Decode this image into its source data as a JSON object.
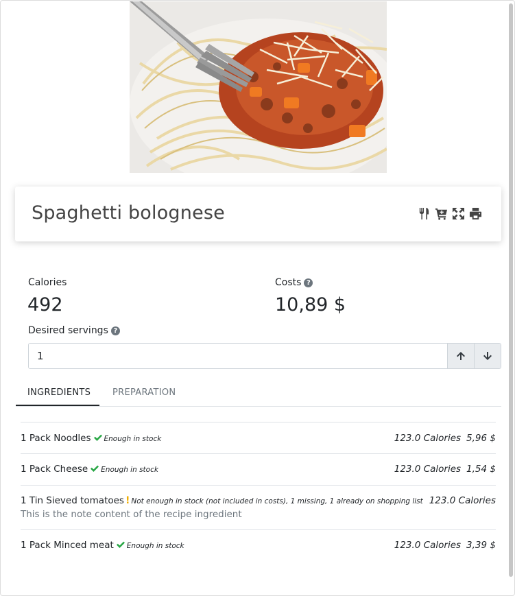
{
  "recipe": {
    "title": "Spaghetti bolognese",
    "hero_image": "spaghetti-bolognese-photo"
  },
  "actions": [
    {
      "icon": "cutlery-icon",
      "label": "cook"
    },
    {
      "icon": "cart-plus-icon",
      "label": "add to shopping list"
    },
    {
      "icon": "expand-icon",
      "label": "fullscreen"
    },
    {
      "icon": "print-icon",
      "label": "print"
    }
  ],
  "stats": {
    "calories_label": "Calories",
    "calories_value": "492",
    "costs_label": "Costs",
    "costs_value": "10,89 $",
    "help_icon": "question-circle-icon"
  },
  "servings": {
    "label": "Desired servings",
    "value": "1",
    "up_icon": "arrow-up-icon",
    "down_icon": "arrow-down-icon"
  },
  "tabs": [
    {
      "label": "INGREDIENTS",
      "active": true
    },
    {
      "label": "PREPARATION",
      "active": false
    }
  ],
  "ingredients": [
    {
      "text": "1 Pack Noodles",
      "status_icon": "check-icon",
      "status": "Enough in stock",
      "calories": "123.0 Calories",
      "cost": "5,96 $",
      "note": ""
    },
    {
      "text": "1 Pack Cheese",
      "status_icon": "check-icon",
      "status": "Enough in stock",
      "calories": "123.0 Calories",
      "cost": "1,54 $",
      "note": ""
    },
    {
      "text": "1 Tin Sieved tomatoes",
      "status_icon": "exclamation-icon",
      "status": "Not enough in stock (not included in costs), 1 missing, 1 already on shopping list",
      "calories": "123.0 Calories",
      "cost": "",
      "note": "This is the note content of the recipe ingredient"
    },
    {
      "text": "1 Pack Minced meat",
      "status_icon": "check-icon",
      "status": "Enough in stock",
      "calories": "123.0 Calories",
      "cost": "3,39 $",
      "note": ""
    }
  ],
  "colors": {
    "ok": "#28a745",
    "warning": "#f0ad00",
    "muted": "#6c757d"
  }
}
